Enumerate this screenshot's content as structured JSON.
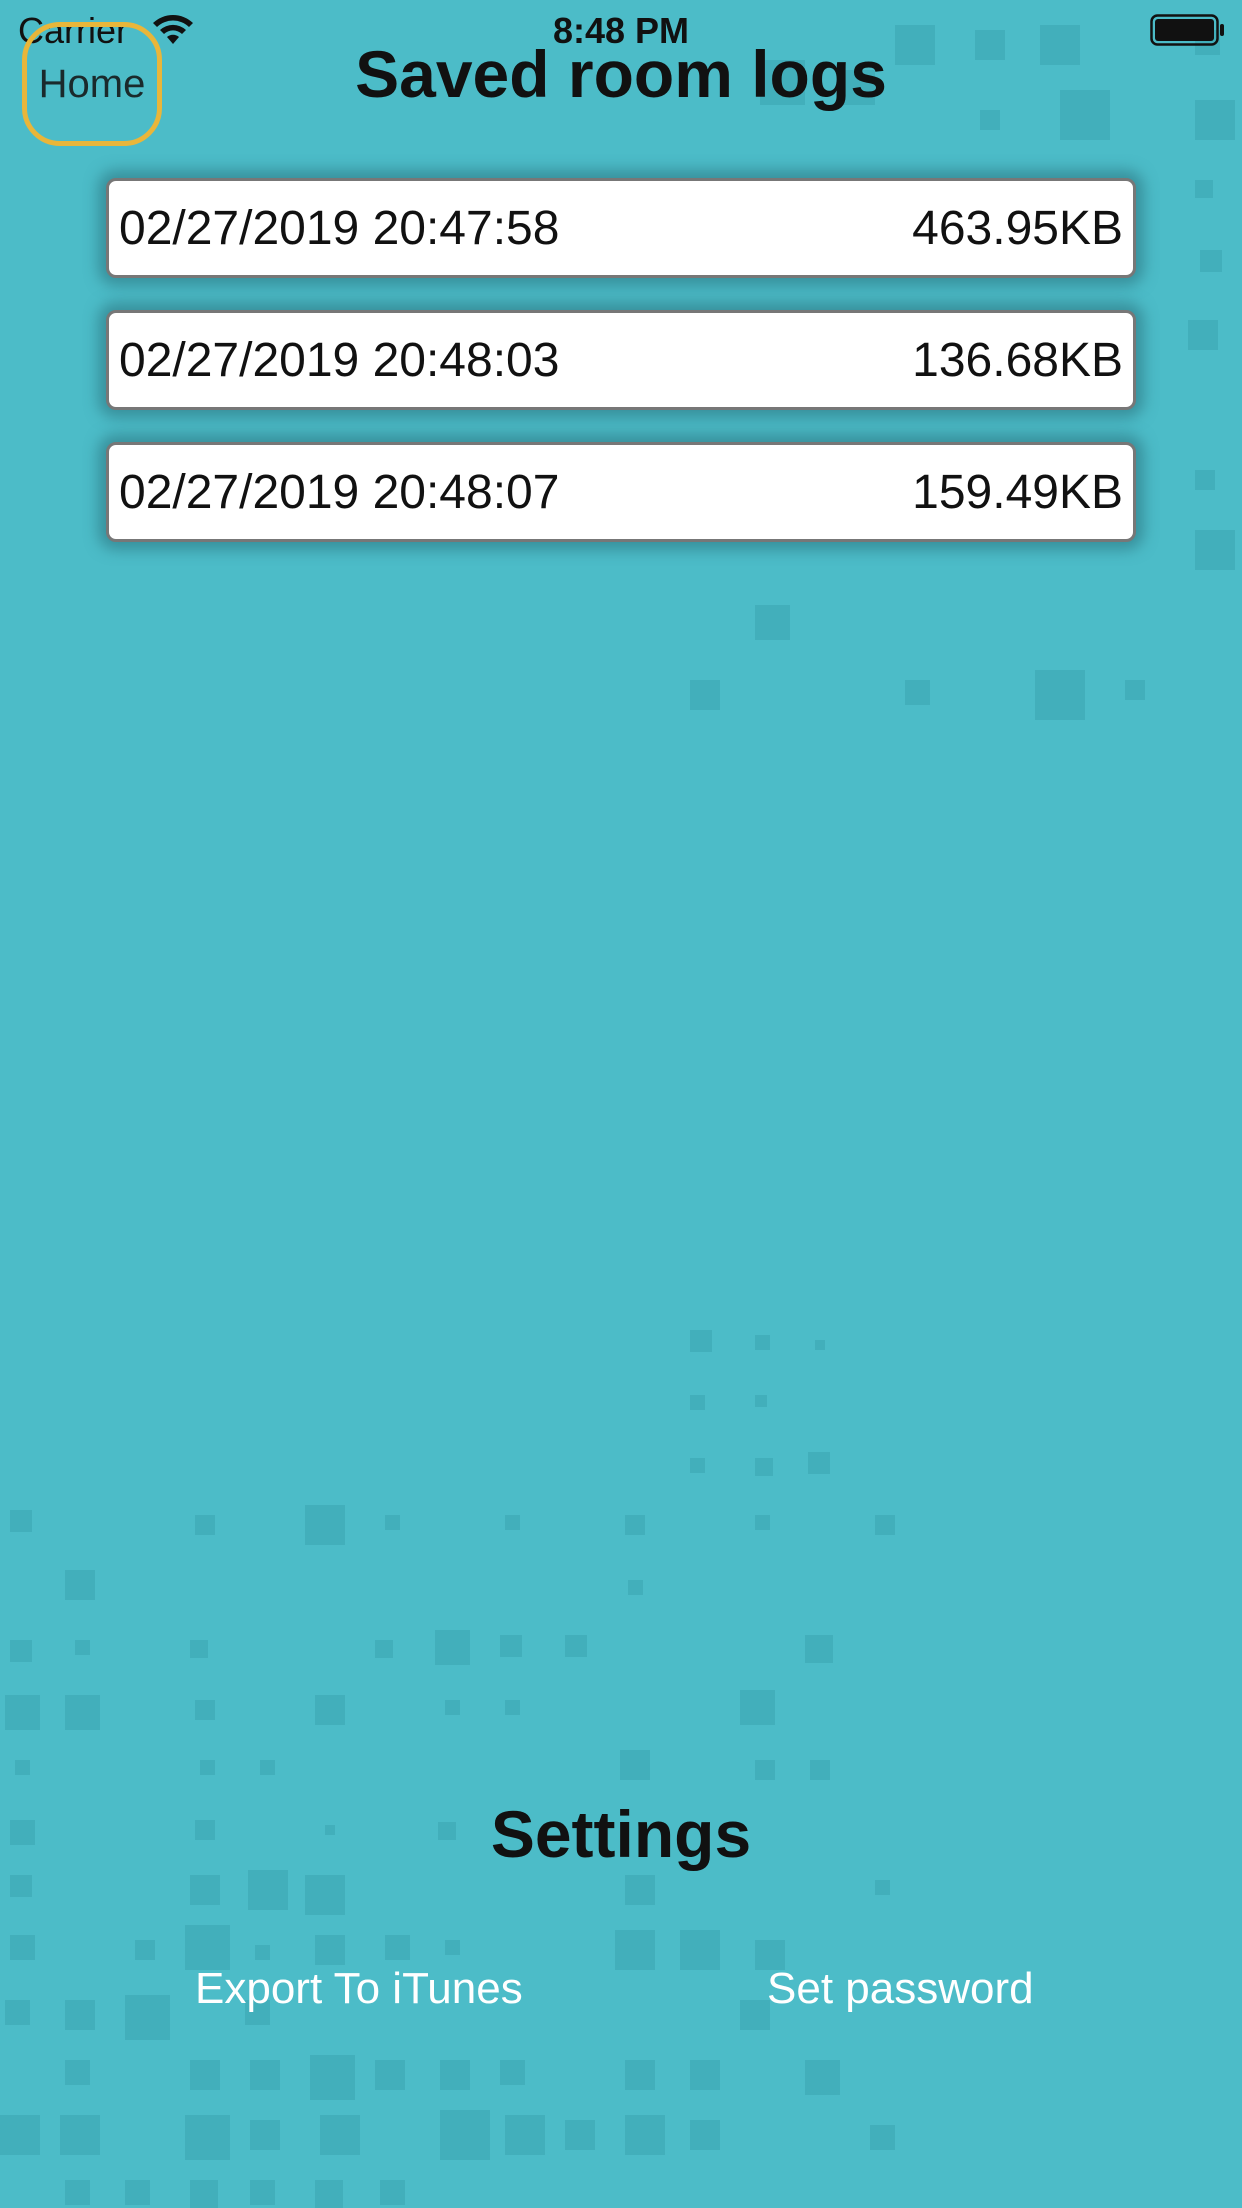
{
  "status_bar": {
    "carrier": "Carrier",
    "time": "8:48 PM"
  },
  "nav": {
    "home_label": "Home",
    "title": "Saved room logs"
  },
  "logs": [
    {
      "timestamp": "02/27/2019 20:47:58",
      "size": "463.95KB"
    },
    {
      "timestamp": "02/27/2019 20:48:03",
      "size": "136.68KB"
    },
    {
      "timestamp": "02/27/2019 20:48:07",
      "size": "159.49KB"
    }
  ],
  "settings": {
    "title": "Settings",
    "export_label": "Export To iTunes",
    "password_label": "Set password"
  },
  "colors": {
    "background": "#4cbcc8",
    "pattern_square": "#3fa9b5",
    "home_highlight": "#e9b63a",
    "row_background": "#ffffff",
    "link_text": "#ffffff"
  },
  "icons": {
    "wifi": "wifi-icon",
    "battery": "battery-icon"
  }
}
